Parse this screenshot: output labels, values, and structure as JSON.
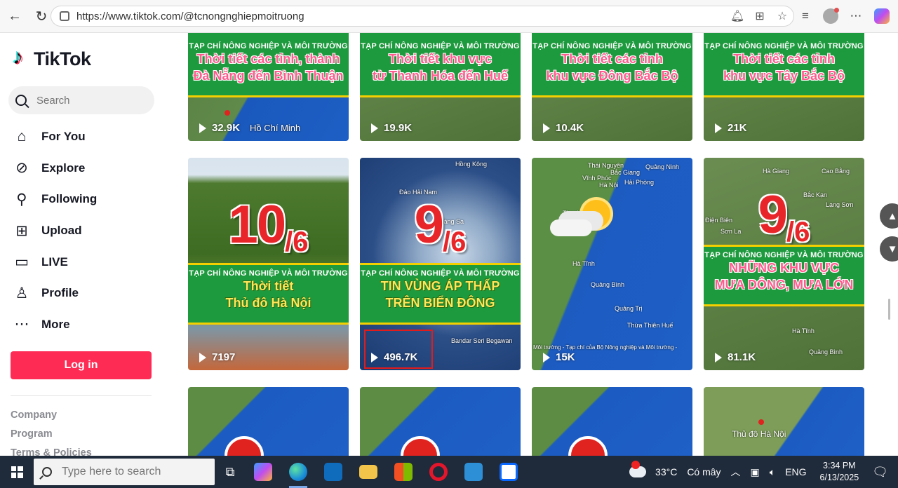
{
  "browser": {
    "url": "https://www.tiktok.com/@tcnongnghiepmoitruong"
  },
  "sidebar": {
    "logo_text": "TikTok",
    "search_placeholder": "Search",
    "items": [
      {
        "label": "For You",
        "icon": "home-icon"
      },
      {
        "label": "Explore",
        "icon": "compass-icon"
      },
      {
        "label": "Following",
        "icon": "following-icon"
      },
      {
        "label": "Upload",
        "icon": "plus-square-icon"
      },
      {
        "label": "LIVE",
        "icon": "live-tv-icon"
      },
      {
        "label": "Profile",
        "icon": "profile-icon"
      },
      {
        "label": "More",
        "icon": "more-dots-icon"
      }
    ],
    "login_label": "Log in",
    "footer": [
      "Company",
      "Program",
      "Terms & Policies"
    ]
  },
  "grid": {
    "magazine": "TẠP CHÍ NÔNG NGHIỆP VÀ MÔI TRƯỜNG",
    "row1": [
      {
        "headline1": "Thời tiết các tỉnh, thành",
        "headline2": "Đà Nẵng đến Bình Thuận",
        "views": "32.9K",
        "map_label": "Hồ Chí Minh"
      },
      {
        "headline1": "Thời tiết khu vực",
        "headline2": "từ Thanh Hóa đến Huế",
        "views": "19.9K"
      },
      {
        "headline1": "Thời tiết các tỉnh",
        "headline2": "khu vực Đông Bắc Bộ",
        "views": "10.4K"
      },
      {
        "headline1": "Thời tiết các tỉnh",
        "headline2": "khu vực Tây Bắc Bộ",
        "views": "21K"
      }
    ],
    "row2": [
      {
        "date_num": "10",
        "date_month": "/6",
        "headline1": "Thời tiết",
        "headline2": "Thủ đô Hà Nội",
        "views": "7197"
      },
      {
        "date_num": "9",
        "date_month": "/6",
        "headline1": "TIN VÙNG ÁP THẤP",
        "headline2": "TRÊN BIỂN ĐÔNG",
        "views": "496.7K",
        "map_labels": [
          "Hồng Kông",
          "Đảo Hải Nam",
          "Hoàng Sa",
          "Bandar Seri Begawan"
        ]
      },
      {
        "views": "15K",
        "map_labels": [
          "Thái Nguyên",
          "Bắc Giang",
          "Quảng Ninh",
          "Vĩnh Phúc",
          "Hà Nội",
          "Hải Phòng",
          "Thanh",
          "Hà Tĩnh",
          "Quảng Bình",
          "Quảng Trị",
          "Thừa Thiên Huế"
        ],
        "caption": "Môi trường - Tạp chí của Bộ Nông nghiệp và Môi trường -"
      },
      {
        "date_num": "9",
        "date_month": "/6",
        "headline1": "NHỮNG KHU VỰC",
        "headline2": "MƯA DÔNG, MƯA LỚN",
        "views": "81.1K",
        "map_labels": [
          "Hà Giang",
          "Cao Bằng",
          "Bắc Kạn",
          "Lạng Sơn",
          "Điện Biên",
          "Sơn La",
          "Hà Tĩnh",
          "Quảng Bình"
        ]
      }
    ],
    "row3": [
      {
        "map_label": ""
      },
      {
        "map_label": ""
      },
      {
        "map_label": ""
      },
      {
        "map_label": "Thủ đô Hà Nội"
      }
    ]
  },
  "taskbar": {
    "search_placeholder": "Type here to search",
    "weather": "33°C",
    "weather_desc": "Có mây",
    "weather_badge": "1",
    "language": "ENG",
    "time": "3:34 PM",
    "date": "6/13/2025"
  }
}
